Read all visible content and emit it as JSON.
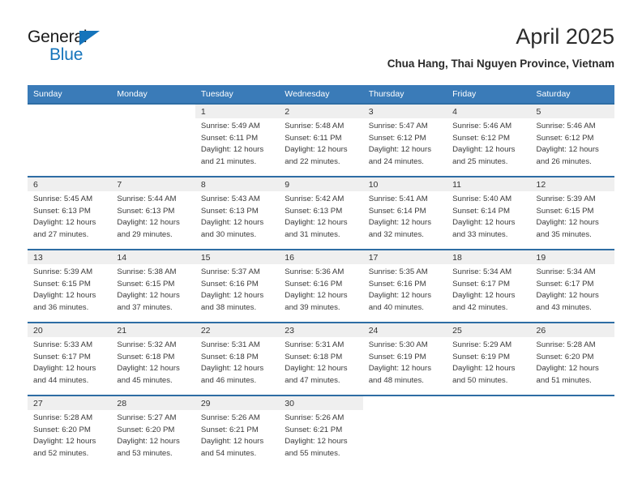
{
  "brand": {
    "name_top": "General",
    "name_bottom": "Blue",
    "triangle_color": "#1574bb"
  },
  "header": {
    "month_title": "April 2025",
    "location": "Chua Hang, Thai Nguyen Province, Vietnam",
    "accent_color": "#3a7bb8",
    "rule_color": "#2e6da4",
    "date_band_color": "#efefef"
  },
  "calendar": {
    "weekday_headers": [
      "Sunday",
      "Monday",
      "Tuesday",
      "Wednesday",
      "Thursday",
      "Friday",
      "Saturday"
    ],
    "weeks": [
      [
        {
          "day": "",
          "sunrise": "",
          "sunset": "",
          "daylight_1": "",
          "daylight_2": ""
        },
        {
          "day": "",
          "sunrise": "",
          "sunset": "",
          "daylight_1": "",
          "daylight_2": ""
        },
        {
          "day": "1",
          "sunrise": "Sunrise: 5:49 AM",
          "sunset": "Sunset: 6:11 PM",
          "daylight_1": "Daylight: 12 hours",
          "daylight_2": "and 21 minutes."
        },
        {
          "day": "2",
          "sunrise": "Sunrise: 5:48 AM",
          "sunset": "Sunset: 6:11 PM",
          "daylight_1": "Daylight: 12 hours",
          "daylight_2": "and 22 minutes."
        },
        {
          "day": "3",
          "sunrise": "Sunrise: 5:47 AM",
          "sunset": "Sunset: 6:12 PM",
          "daylight_1": "Daylight: 12 hours",
          "daylight_2": "and 24 minutes."
        },
        {
          "day": "4",
          "sunrise": "Sunrise: 5:46 AM",
          "sunset": "Sunset: 6:12 PM",
          "daylight_1": "Daylight: 12 hours",
          "daylight_2": "and 25 minutes."
        },
        {
          "day": "5",
          "sunrise": "Sunrise: 5:46 AM",
          "sunset": "Sunset: 6:12 PM",
          "daylight_1": "Daylight: 12 hours",
          "daylight_2": "and 26 minutes."
        }
      ],
      [
        {
          "day": "6",
          "sunrise": "Sunrise: 5:45 AM",
          "sunset": "Sunset: 6:13 PM",
          "daylight_1": "Daylight: 12 hours",
          "daylight_2": "and 27 minutes."
        },
        {
          "day": "7",
          "sunrise": "Sunrise: 5:44 AM",
          "sunset": "Sunset: 6:13 PM",
          "daylight_1": "Daylight: 12 hours",
          "daylight_2": "and 29 minutes."
        },
        {
          "day": "8",
          "sunrise": "Sunrise: 5:43 AM",
          "sunset": "Sunset: 6:13 PM",
          "daylight_1": "Daylight: 12 hours",
          "daylight_2": "and 30 minutes."
        },
        {
          "day": "9",
          "sunrise": "Sunrise: 5:42 AM",
          "sunset": "Sunset: 6:13 PM",
          "daylight_1": "Daylight: 12 hours",
          "daylight_2": "and 31 minutes."
        },
        {
          "day": "10",
          "sunrise": "Sunrise: 5:41 AM",
          "sunset": "Sunset: 6:14 PM",
          "daylight_1": "Daylight: 12 hours",
          "daylight_2": "and 32 minutes."
        },
        {
          "day": "11",
          "sunrise": "Sunrise: 5:40 AM",
          "sunset": "Sunset: 6:14 PM",
          "daylight_1": "Daylight: 12 hours",
          "daylight_2": "and 33 minutes."
        },
        {
          "day": "12",
          "sunrise": "Sunrise: 5:39 AM",
          "sunset": "Sunset: 6:15 PM",
          "daylight_1": "Daylight: 12 hours",
          "daylight_2": "and 35 minutes."
        }
      ],
      [
        {
          "day": "13",
          "sunrise": "Sunrise: 5:39 AM",
          "sunset": "Sunset: 6:15 PM",
          "daylight_1": "Daylight: 12 hours",
          "daylight_2": "and 36 minutes."
        },
        {
          "day": "14",
          "sunrise": "Sunrise: 5:38 AM",
          "sunset": "Sunset: 6:15 PM",
          "daylight_1": "Daylight: 12 hours",
          "daylight_2": "and 37 minutes."
        },
        {
          "day": "15",
          "sunrise": "Sunrise: 5:37 AM",
          "sunset": "Sunset: 6:16 PM",
          "daylight_1": "Daylight: 12 hours",
          "daylight_2": "and 38 minutes."
        },
        {
          "day": "16",
          "sunrise": "Sunrise: 5:36 AM",
          "sunset": "Sunset: 6:16 PM",
          "daylight_1": "Daylight: 12 hours",
          "daylight_2": "and 39 minutes."
        },
        {
          "day": "17",
          "sunrise": "Sunrise: 5:35 AM",
          "sunset": "Sunset: 6:16 PM",
          "daylight_1": "Daylight: 12 hours",
          "daylight_2": "and 40 minutes."
        },
        {
          "day": "18",
          "sunrise": "Sunrise: 5:34 AM",
          "sunset": "Sunset: 6:17 PM",
          "daylight_1": "Daylight: 12 hours",
          "daylight_2": "and 42 minutes."
        },
        {
          "day": "19",
          "sunrise": "Sunrise: 5:34 AM",
          "sunset": "Sunset: 6:17 PM",
          "daylight_1": "Daylight: 12 hours",
          "daylight_2": "and 43 minutes."
        }
      ],
      [
        {
          "day": "20",
          "sunrise": "Sunrise: 5:33 AM",
          "sunset": "Sunset: 6:17 PM",
          "daylight_1": "Daylight: 12 hours",
          "daylight_2": "and 44 minutes."
        },
        {
          "day": "21",
          "sunrise": "Sunrise: 5:32 AM",
          "sunset": "Sunset: 6:18 PM",
          "daylight_1": "Daylight: 12 hours",
          "daylight_2": "and 45 minutes."
        },
        {
          "day": "22",
          "sunrise": "Sunrise: 5:31 AM",
          "sunset": "Sunset: 6:18 PM",
          "daylight_1": "Daylight: 12 hours",
          "daylight_2": "and 46 minutes."
        },
        {
          "day": "23",
          "sunrise": "Sunrise: 5:31 AM",
          "sunset": "Sunset: 6:18 PM",
          "daylight_1": "Daylight: 12 hours",
          "daylight_2": "and 47 minutes."
        },
        {
          "day": "24",
          "sunrise": "Sunrise: 5:30 AM",
          "sunset": "Sunset: 6:19 PM",
          "daylight_1": "Daylight: 12 hours",
          "daylight_2": "and 48 minutes."
        },
        {
          "day": "25",
          "sunrise": "Sunrise: 5:29 AM",
          "sunset": "Sunset: 6:19 PM",
          "daylight_1": "Daylight: 12 hours",
          "daylight_2": "and 50 minutes."
        },
        {
          "day": "26",
          "sunrise": "Sunrise: 5:28 AM",
          "sunset": "Sunset: 6:20 PM",
          "daylight_1": "Daylight: 12 hours",
          "daylight_2": "and 51 minutes."
        }
      ],
      [
        {
          "day": "27",
          "sunrise": "Sunrise: 5:28 AM",
          "sunset": "Sunset: 6:20 PM",
          "daylight_1": "Daylight: 12 hours",
          "daylight_2": "and 52 minutes."
        },
        {
          "day": "28",
          "sunrise": "Sunrise: 5:27 AM",
          "sunset": "Sunset: 6:20 PM",
          "daylight_1": "Daylight: 12 hours",
          "daylight_2": "and 53 minutes."
        },
        {
          "day": "29",
          "sunrise": "Sunrise: 5:26 AM",
          "sunset": "Sunset: 6:21 PM",
          "daylight_1": "Daylight: 12 hours",
          "daylight_2": "and 54 minutes."
        },
        {
          "day": "30",
          "sunrise": "Sunrise: 5:26 AM",
          "sunset": "Sunset: 6:21 PM",
          "daylight_1": "Daylight: 12 hours",
          "daylight_2": "and 55 minutes."
        },
        {
          "day": "",
          "sunrise": "",
          "sunset": "",
          "daylight_1": "",
          "daylight_2": ""
        },
        {
          "day": "",
          "sunrise": "",
          "sunset": "",
          "daylight_1": "",
          "daylight_2": ""
        },
        {
          "day": "",
          "sunrise": "",
          "sunset": "",
          "daylight_1": "",
          "daylight_2": ""
        }
      ]
    ]
  }
}
